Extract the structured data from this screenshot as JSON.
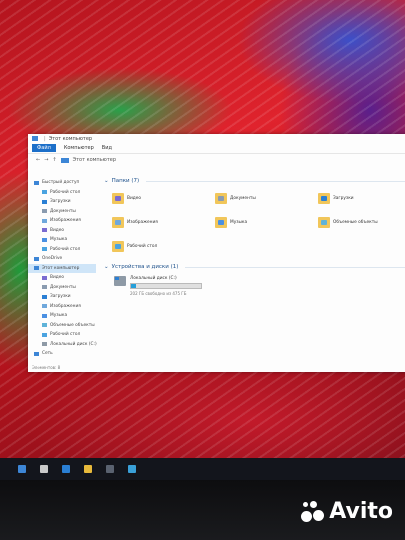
{
  "window": {
    "title": "Этот компьютер",
    "ribbon": [
      "Файл",
      "Компьютер",
      "Вид"
    ],
    "breadcrumb": "Этот компьютер",
    "status": "Элементов: 8"
  },
  "sidebar": {
    "items": [
      {
        "label": "Быстрый доступ",
        "color": "#3d86d6",
        "indent": 0
      },
      {
        "label": "Рабочий стол",
        "color": "#4aa3e0",
        "indent": 1
      },
      {
        "label": "Загрузки",
        "color": "#2a7fd4",
        "indent": 1
      },
      {
        "label": "Документы",
        "color": "#8a9bb0",
        "indent": 1
      },
      {
        "label": "Изображения",
        "color": "#6fa8dc",
        "indent": 1
      },
      {
        "label": "Видео",
        "color": "#7a6bd1",
        "indent": 1
      },
      {
        "label": "Музыка",
        "color": "#4a90e2",
        "indent": 1
      },
      {
        "label": "Рабочий стол",
        "color": "#4aa3e0",
        "indent": 1
      },
      {
        "label": "OneDrive",
        "color": "#3d86d6",
        "indent": 0
      },
      {
        "label": "Этот компьютер",
        "color": "#3d86d6",
        "indent": 0,
        "selected": true
      },
      {
        "label": "Видео",
        "color": "#7a6bd1",
        "indent": 1
      },
      {
        "label": "Документы",
        "color": "#8a9bb0",
        "indent": 1
      },
      {
        "label": "Загрузки",
        "color": "#2a7fd4",
        "indent": 1
      },
      {
        "label": "Изображения",
        "color": "#6fa8dc",
        "indent": 1
      },
      {
        "label": "Музыка",
        "color": "#4a90e2",
        "indent": 1
      },
      {
        "label": "Объемные объекты",
        "color": "#5fb3d9",
        "indent": 1
      },
      {
        "label": "Рабочий стол",
        "color": "#4aa3e0",
        "indent": 1
      },
      {
        "label": "Локальный диск (C:)",
        "color": "#8e9aa6",
        "indent": 1
      },
      {
        "label": "Сеть",
        "color": "#3d86d6",
        "indent": 0
      }
    ]
  },
  "folders": {
    "header": "Папки (7)",
    "items": [
      {
        "label": "Видео",
        "badge": "#7a6bd1"
      },
      {
        "label": "Документы",
        "badge": "#8a9bb0"
      },
      {
        "label": "Загрузки",
        "badge": "#2a7fd4"
      },
      {
        "label": "Изображения",
        "badge": "#6fa8dc"
      },
      {
        "label": "Музыка",
        "badge": "#4a90e2"
      },
      {
        "label": "Объемные объекты",
        "badge": "#5fb3d9"
      },
      {
        "label": "Рабочий стол",
        "badge": "#4aa3e0"
      }
    ]
  },
  "devices": {
    "header": "Устройства и диски (1)",
    "drive": {
      "label": "Локальный диск (C:)",
      "used_fraction": 0.07,
      "free_text": "202 ГБ свободно из 475 ГБ"
    }
  },
  "taskbar": {
    "icons": [
      "#3d86d6",
      "#c9c9c9",
      "#2a7fd4",
      "#e7b93b",
      "#5a6270",
      "#3aa0d8"
    ]
  },
  "watermark": "Avito"
}
